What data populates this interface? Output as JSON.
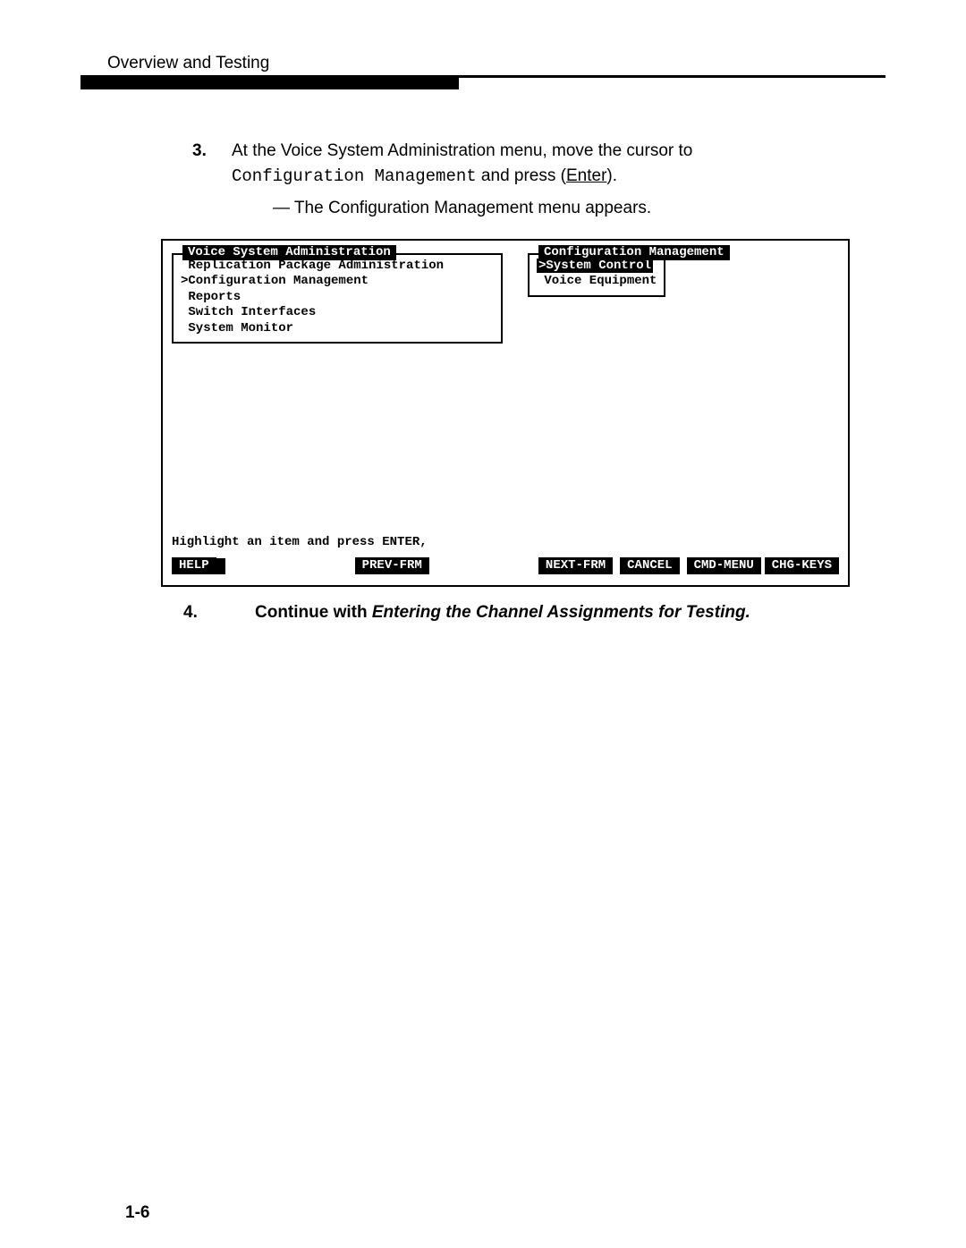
{
  "header": {
    "running_head": "Overview and Testing"
  },
  "steps": {
    "s3": {
      "num": "3.",
      "line1_a": "At the Voice System Administration menu, move the cursor to",
      "line2_mono": "Configuration Management",
      "line2_b": " and press (",
      "line2_key": "Enter",
      "line2_c": ").",
      "sub": "— The Configuration Management menu appears."
    },
    "s4": {
      "num": "4.",
      "lead": "Continue with ",
      "emph": "Entering  the Channel  Assignments for Testing."
    }
  },
  "terminal": {
    "left": {
      "title": "Voice System Administration",
      "items": [
        " Replication Package Administration",
        ">Configuration Management",
        " Reports",
        " Switch Interfaces",
        " System Monitor"
      ]
    },
    "right": {
      "title": "Configuration Management",
      "selected": ">System Control",
      "other": " Voice Equipment"
    },
    "prompt": "Highlight an item and press ENTER,",
    "fkeys": {
      "help": "HELP",
      "prev": "PREV-FRM",
      "next": "NEXT-FRM",
      "cancel": "CANCEL",
      "cmd": "CMD-MENU",
      "chg": "CHG-KEYS"
    }
  },
  "page_number": "1-6"
}
